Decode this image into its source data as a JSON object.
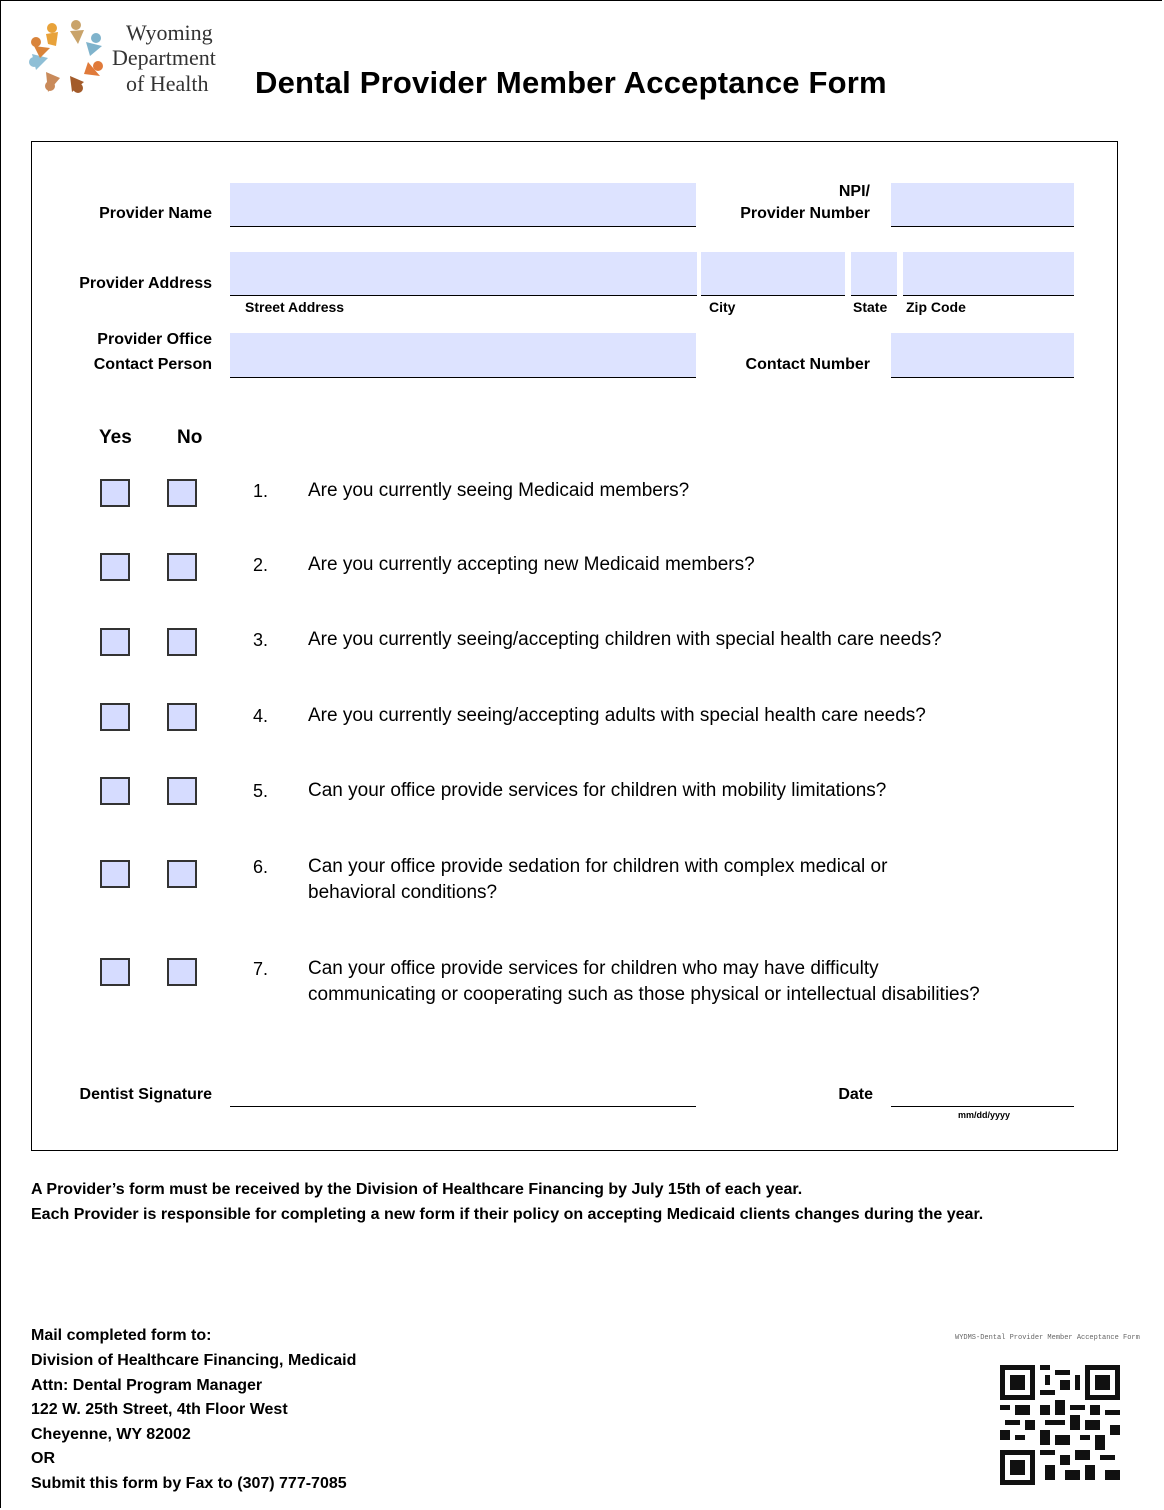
{
  "header": {
    "logo_lines": [
      "Wyoming",
      "Department",
      "of Health"
    ],
    "title": "Dental Provider Member Acceptance Form"
  },
  "provider": {
    "name_label": "Provider Name",
    "npi_label_line1": "NPI/",
    "npi_label_line2": "Provider Number",
    "address_label": "Provider Address",
    "street_label": "Street Address",
    "city_label": "City",
    "state_label": "State",
    "zip_label": "Zip Code",
    "contact_label_line1": "Provider Office",
    "contact_label_line2": "Contact Person",
    "contact_number_label": "Contact Number"
  },
  "questions_header": {
    "yes": "Yes",
    "no": "No"
  },
  "questions": [
    {
      "num": "1.",
      "text": "Are you currently seeing Medicaid members?"
    },
    {
      "num": "2.",
      "text": "Are you currently accepting new Medicaid members?"
    },
    {
      "num": "3.",
      "text": "Are you currently seeing/accepting children with special health care needs?"
    },
    {
      "num": "4.",
      "text": "Are you currently seeing/accepting adults with special health care needs?"
    },
    {
      "num": "5.",
      "text": "Can your office provide services for children with mobility limitations?"
    },
    {
      "num": "6.",
      "text": "Can your office provide sedation for children with complex medical or",
      "text2": "behavioral conditions?"
    },
    {
      "num": "7.",
      "text": "Can your office provide services for children who may have difficulty",
      "text2": "communicating or cooperating such as those physical or intellectual disabilities?"
    }
  ],
  "signature": {
    "label": "Dentist Signature",
    "date_label": "Date",
    "date_format": "mm/dd/yyyy"
  },
  "notes": [
    "A Provider’s form must be received by the Division of Healthcare Financing by July 15th of each year.",
    "Each Provider is responsible for completing a new form if their policy on accepting Medicaid clients changes during the year."
  ],
  "mail": {
    "heading": "Mail completed form to:",
    "lines": [
      "Division of Healthcare Financing, Medicaid",
      "Attn: Dental Program Manager",
      "122 W. 25th Street, 4th Floor West",
      "Cheyenne, WY 82002",
      "OR",
      "Submit this form by Fax to (307) 777-7085"
    ]
  },
  "footer": {
    "form_id": "WYDMS-Dental Provider Member Acceptance Form"
  }
}
